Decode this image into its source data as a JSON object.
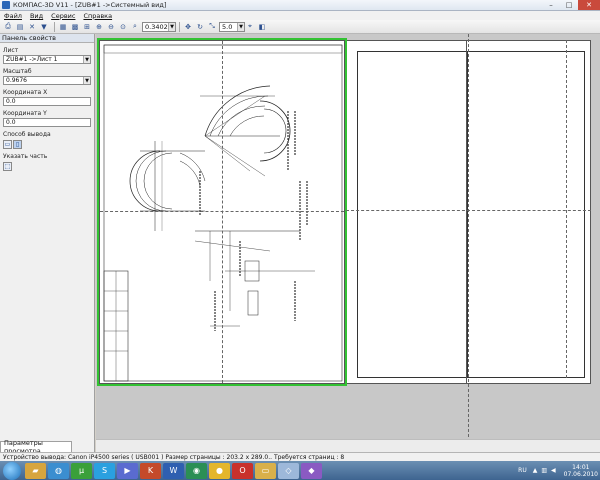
{
  "window": {
    "title": "КОМПАС-3D V11 - [ZUB#1 ->Системный вид]",
    "buttons": {
      "minimize": "–",
      "maximize": "□",
      "close": "✕"
    }
  },
  "menu": [
    "Файл",
    "Вид",
    "Сервис",
    "Справка"
  ],
  "toolbar": {
    "zoom_value": "0.3402",
    "step_value": "5.0"
  },
  "panel": {
    "title": "Панель свойств",
    "sheet_label": "Лист",
    "sheet_value": "ZUB#1 ->Лист 1",
    "scale_label": "Масштаб",
    "scale_value": "0.9676",
    "coord_x_label": "Координата X",
    "coord_x_value": "0.0",
    "coord_y_label": "Координата Y",
    "coord_y_value": "0.0",
    "output_label": "Способ вывода",
    "part_label": "Указать часть",
    "tab_label": "Параметры просмотра"
  },
  "status": {
    "text": "Устройство вывода: Canon iP4500 series ( USB001 )  Размер страницы : 203.2 x 289.0..  Требуется страниц : 8"
  },
  "taskbar": {
    "lang": "RU",
    "time": "14:01",
    "date": "07.06.2010"
  },
  "colors": {
    "selection_border": "#33c233",
    "start_orb": "#1b6fb8"
  }
}
